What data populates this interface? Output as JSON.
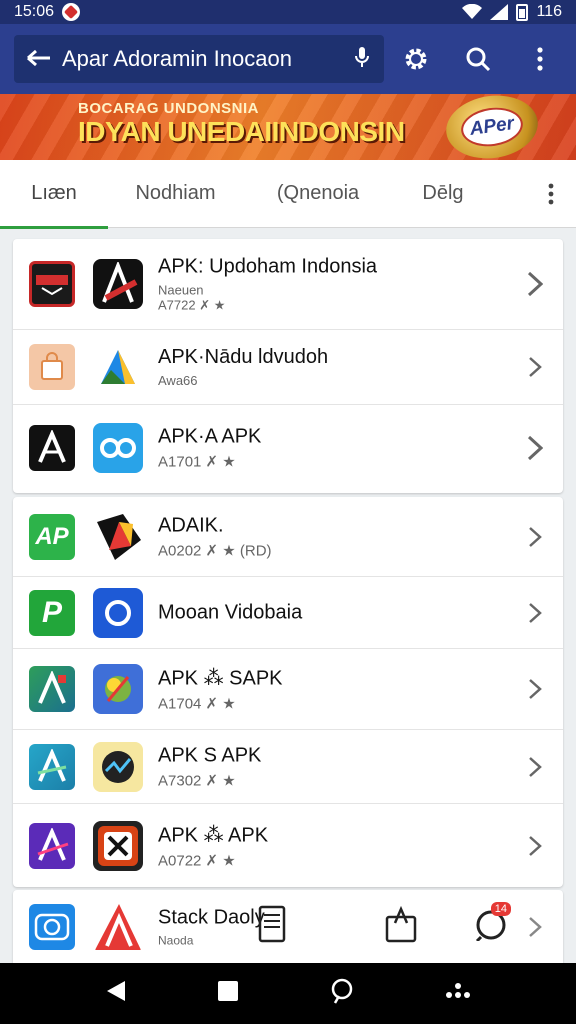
{
  "status_bar": {
    "time": "15:06",
    "battery_text": "116"
  },
  "search": {
    "title": "Apar Adoramin Inocaon"
  },
  "banner": {
    "line1": "BOCARAG UNDONSNIA",
    "line2": "IDYAN UNEDAIINDONSIN",
    "badge_text": "APer"
  },
  "tabs": [
    {
      "label": "Lıæn"
    },
    {
      "label": "Nodhiam"
    },
    {
      "label": "(Qnenoia"
    },
    {
      "label": "Dēlg"
    }
  ],
  "group1": [
    {
      "name": "APK: Updoham Indonsia",
      "sub": "Naeuen\nA7722 ✗ ★"
    },
    {
      "name": "APK·Nādu ldvudoh",
      "sub": "Awa66"
    },
    {
      "name": "APK·A APK",
      "sub": "A1701 ✗ ★"
    }
  ],
  "group2": [
    {
      "name": "ADAIK.",
      "sub": "A0202 ✗ ★ (RD)"
    },
    {
      "name": "Mooan Vidobaia",
      "sub": ""
    },
    {
      "name": "APK ⁂ SAPK",
      "sub": "A1704 ✗ ★"
    },
    {
      "name": "APK S APK",
      "sub": "A7302 ✗ ★"
    },
    {
      "name": "APK ⁂ APK",
      "sub": "A0722 ✗ ★"
    }
  ],
  "group3": [
    {
      "name": "Stack Daoly",
      "sub": "Naoda"
    }
  ],
  "notification_count": "14",
  "icons": {
    "g1": [
      [
        "ap-red-icon",
        "a-red-app-icon"
      ],
      [
        "shop-icon",
        "a-triangle-icon"
      ],
      [
        "a-black-icon",
        "cloud-link-icon"
      ]
    ],
    "g2": [
      [
        "ap-green-icon",
        "play-arrow-icon"
      ],
      [
        "p-green-icon",
        "o-blue-icon"
      ],
      [
        "a-stack-icon",
        "gear-coin-icon"
      ],
      [
        "a-teal-icon",
        "chart-gauge-icon"
      ],
      [
        "a-purple-icon",
        "x-shield-icon"
      ]
    ],
    "g3": [
      [
        "cd-blue-icon",
        "a-red-app-icon"
      ]
    ]
  }
}
